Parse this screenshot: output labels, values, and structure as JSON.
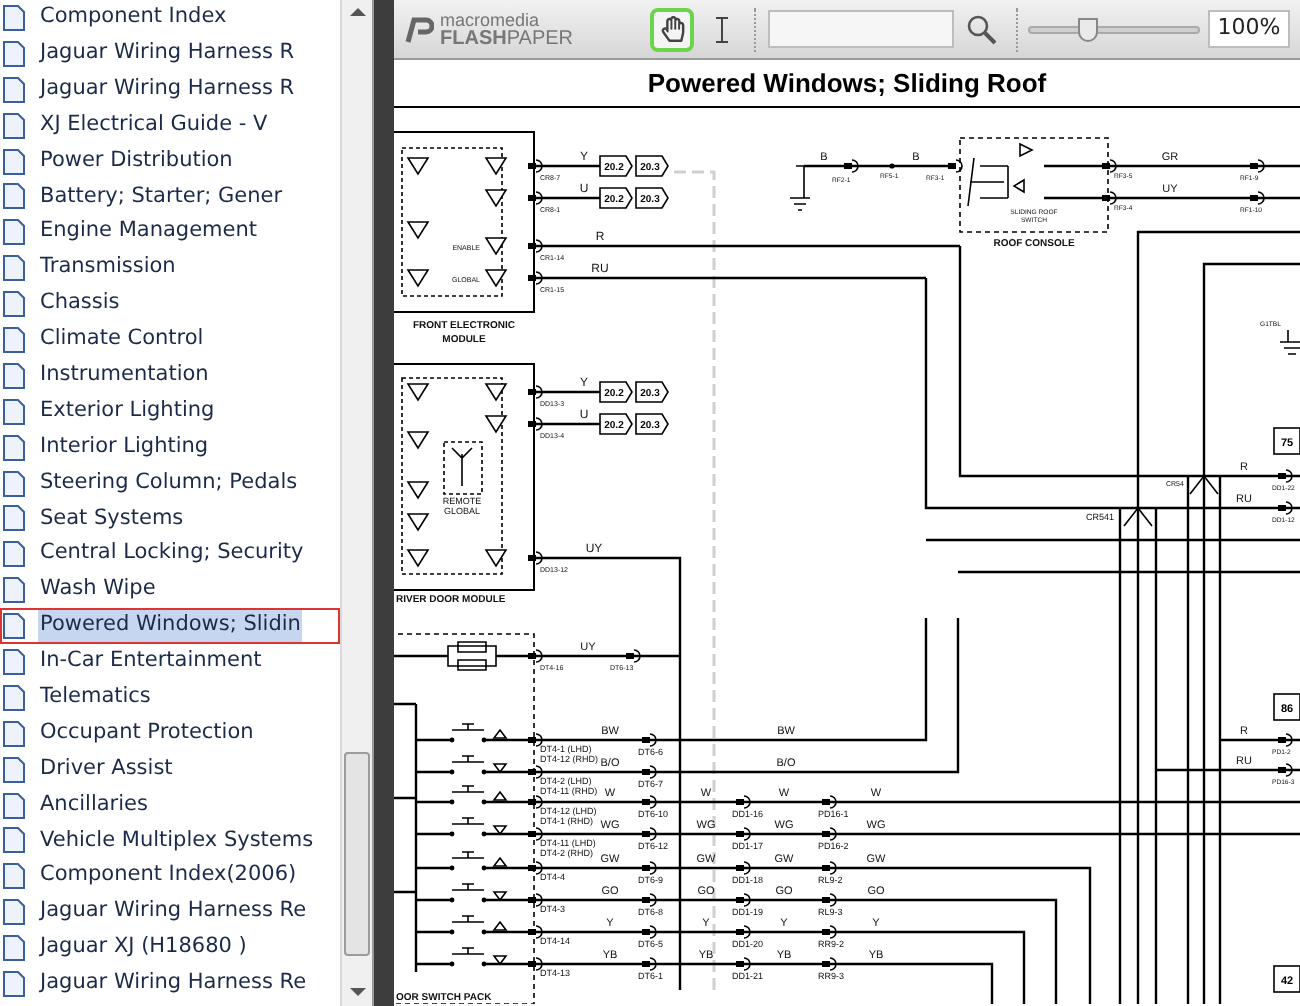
{
  "sidebar": {
    "items": [
      {
        "label": "Component Index",
        "selected": false
      },
      {
        "label": "Jaguar Wiring Harness R",
        "selected": false
      },
      {
        "label": "Jaguar Wiring Harness R",
        "selected": false
      },
      {
        "label": "XJ Electrical Guide - V",
        "selected": false
      },
      {
        "label": "Power Distribution",
        "selected": false
      },
      {
        "label": "Battery; Starter; Gener",
        "selected": false
      },
      {
        "label": "Engine Management",
        "selected": false
      },
      {
        "label": "Transmission",
        "selected": false
      },
      {
        "label": "Chassis",
        "selected": false
      },
      {
        "label": "Climate Control",
        "selected": false
      },
      {
        "label": "Instrumentation",
        "selected": false
      },
      {
        "label": "Exterior Lighting",
        "selected": false
      },
      {
        "label": "Interior Lighting",
        "selected": false
      },
      {
        "label": "Steering Column; Pedals",
        "selected": false
      },
      {
        "label": "Seat Systems",
        "selected": false
      },
      {
        "label": "Central Locking; Security",
        "selected": false
      },
      {
        "label": "Wash Wipe",
        "selected": false
      },
      {
        "label": "Powered Windows; Slidin",
        "selected": true
      },
      {
        "label": "In-Car Entertainment",
        "selected": false
      },
      {
        "label": "Telematics",
        "selected": false
      },
      {
        "label": "Occupant Protection",
        "selected": false
      },
      {
        "label": "Driver Assist",
        "selected": false
      },
      {
        "label": "Ancillaries",
        "selected": false
      },
      {
        "label": "Vehicle Multiplex Systems",
        "selected": false
      },
      {
        "label": "Component Index(2006)",
        "selected": false
      },
      {
        "label": "Jaguar Wiring Harness Re",
        "selected": false
      },
      {
        "label": "Jaguar XJ (H18680 )",
        "selected": false
      },
      {
        "label": "Jaguar Wiring Harness Re",
        "selected": false
      }
    ]
  },
  "toolbar": {
    "logo_top": "macromedia",
    "logo_bottom": "**FLASH**PAPER",
    "hand_tool": {
      "selected": true
    },
    "text_tool": {
      "selected": false
    },
    "zoom": {
      "level": 0.35,
      "value": "100%"
    }
  },
  "document": {
    "title": "Powered Windows; Sliding Roof",
    "front_module": {
      "label_lines": [
        "FRONT ELECTRONIC",
        "MODULE"
      ],
      "pins": [
        "ENABLE",
        "GLOBAL"
      ],
      "wires": [
        {
          "code": "Y",
          "connector": "CR8-7",
          "refs": [
            "20.2",
            "20.3"
          ]
        },
        {
          "code": "U",
          "connector": "CR8-1",
          "refs": [
            "20.2",
            "20.3"
          ]
        },
        {
          "code": "R",
          "connector": "CR1-14"
        },
        {
          "code": "RU",
          "connector": "CR1-15"
        }
      ]
    },
    "door_module": {
      "label": "RIVER DOOR MODULE",
      "inset_lines": [
        "REMOTE",
        "GLOBAL"
      ],
      "wires": [
        {
          "code": "Y",
          "connector": "DD13-3",
          "refs": [
            "20.2",
            "20.3"
          ]
        },
        {
          "code": "U",
          "connector": "DD13-4",
          "refs": [
            "20.2",
            "20.3"
          ]
        },
        {
          "code": "UY",
          "connector": "DD13-12"
        }
      ]
    },
    "roof_console": {
      "label": "ROOF CONSOLE",
      "switch_lines": [
        "SLIDING ROOF",
        "SWITCH"
      ],
      "feed_codes": [
        "B",
        "B"
      ],
      "feed_connectors": [
        "RF2-1",
        "RF5-1",
        "RF3-1"
      ],
      "outputs": [
        {
          "code": "GR",
          "connectors": [
            "RF3-5",
            "RF1-9"
          ]
        },
        {
          "code": "UY",
          "connectors": [
            "RF3-4",
            "RF1-10"
          ]
        }
      ]
    },
    "ground_label": "G1TBL",
    "splices": [
      "CR54",
      "CR541"
    ],
    "right_wires": [
      {
        "code": "R",
        "connector": "DD1-22"
      },
      {
        "code": "RU",
        "connector": "DD1-12"
      },
      {
        "code": "R",
        "connector": "PD1-2"
      },
      {
        "code": "RU",
        "connector": "PD16-3"
      }
    ],
    "page_refs": [
      "75",
      "86",
      "42"
    ],
    "switch_pack": {
      "label": "OOR SWITCH PACK",
      "uy": {
        "code": "UY",
        "connectors": [
          "DT4-16",
          "DT6-13"
        ]
      },
      "rows": [
        {
          "codes": [
            "BW",
            "BW"
          ],
          "pins": [
            "DT4-1 (LHD)",
            "DT4-12 (RHD)"
          ],
          "connectors": [
            "DT6-6"
          ]
        },
        {
          "codes": [
            "B/O",
            "B/O"
          ],
          "pins": [
            "DT4-2 (LHD)",
            "DT4-11 (RHD)"
          ],
          "connectors": [
            "DT6-7"
          ]
        },
        {
          "codes": [
            "W",
            "W",
            "W",
            "W"
          ],
          "pins": [
            "DT4-12 (LHD)",
            "DT4-1 (RHD)"
          ],
          "connectors": [
            "DT6-10",
            "DD1-16",
            "PD16-1"
          ]
        },
        {
          "codes": [
            "WG",
            "WG",
            "WG",
            "WG"
          ],
          "pins": [
            "DT4-11 (LHD)",
            "DT4-2 (RHD)"
          ],
          "connectors": [
            "DT6-12",
            "DD1-17",
            "PD16-2"
          ]
        },
        {
          "codes": [
            "GW",
            "GW",
            "GW",
            "GW"
          ],
          "pins": [
            "DT4-4"
          ],
          "connectors": [
            "DT6-9",
            "DD1-18",
            "RL9-2"
          ]
        },
        {
          "codes": [
            "GO",
            "GO",
            "GO",
            "GO"
          ],
          "pins": [
            "DT4-3"
          ],
          "connectors": [
            "DT6-8",
            "DD1-19",
            "RL9-3"
          ]
        },
        {
          "codes": [
            "Y",
            "Y",
            "Y",
            "Y"
          ],
          "pins": [
            "DT4-14"
          ],
          "connectors": [
            "DT6-5",
            "DD1-20",
            "RR9-2"
          ]
        },
        {
          "codes": [
            "YB",
            "YB",
            "YB",
            "YB"
          ],
          "pins": [
            "DT4-13"
          ],
          "connectors": [
            "DT6-1",
            "DD1-21",
            "RR9-3"
          ]
        }
      ]
    }
  }
}
